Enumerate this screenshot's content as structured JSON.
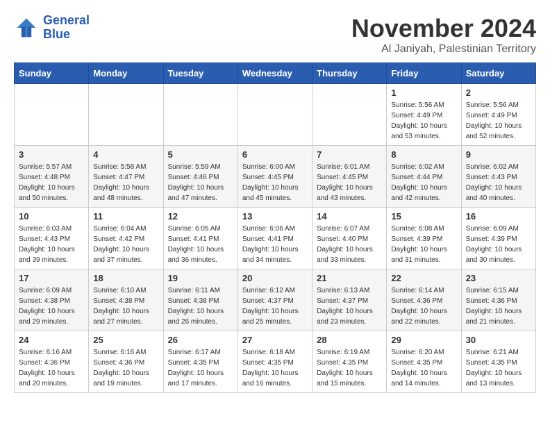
{
  "header": {
    "logo_line1": "General",
    "logo_line2": "Blue",
    "month": "November 2024",
    "location": "Al Janiyah, Palestinian Territory"
  },
  "weekdays": [
    "Sunday",
    "Monday",
    "Tuesday",
    "Wednesday",
    "Thursday",
    "Friday",
    "Saturday"
  ],
  "weeks": [
    [
      {
        "day": "",
        "info": ""
      },
      {
        "day": "",
        "info": ""
      },
      {
        "day": "",
        "info": ""
      },
      {
        "day": "",
        "info": ""
      },
      {
        "day": "",
        "info": ""
      },
      {
        "day": "1",
        "info": "Sunrise: 5:56 AM\nSunset: 4:49 PM\nDaylight: 10 hours\nand 53 minutes."
      },
      {
        "day": "2",
        "info": "Sunrise: 5:56 AM\nSunset: 4:49 PM\nDaylight: 10 hours\nand 52 minutes."
      }
    ],
    [
      {
        "day": "3",
        "info": "Sunrise: 5:57 AM\nSunset: 4:48 PM\nDaylight: 10 hours\nand 50 minutes."
      },
      {
        "day": "4",
        "info": "Sunrise: 5:58 AM\nSunset: 4:47 PM\nDaylight: 10 hours\nand 48 minutes."
      },
      {
        "day": "5",
        "info": "Sunrise: 5:59 AM\nSunset: 4:46 PM\nDaylight: 10 hours\nand 47 minutes."
      },
      {
        "day": "6",
        "info": "Sunrise: 6:00 AM\nSunset: 4:45 PM\nDaylight: 10 hours\nand 45 minutes."
      },
      {
        "day": "7",
        "info": "Sunrise: 6:01 AM\nSunset: 4:45 PM\nDaylight: 10 hours\nand 43 minutes."
      },
      {
        "day": "8",
        "info": "Sunrise: 6:02 AM\nSunset: 4:44 PM\nDaylight: 10 hours\nand 42 minutes."
      },
      {
        "day": "9",
        "info": "Sunrise: 6:02 AM\nSunset: 4:43 PM\nDaylight: 10 hours\nand 40 minutes."
      }
    ],
    [
      {
        "day": "10",
        "info": "Sunrise: 6:03 AM\nSunset: 4:43 PM\nDaylight: 10 hours\nand 39 minutes."
      },
      {
        "day": "11",
        "info": "Sunrise: 6:04 AM\nSunset: 4:42 PM\nDaylight: 10 hours\nand 37 minutes."
      },
      {
        "day": "12",
        "info": "Sunrise: 6:05 AM\nSunset: 4:41 PM\nDaylight: 10 hours\nand 36 minutes."
      },
      {
        "day": "13",
        "info": "Sunrise: 6:06 AM\nSunset: 4:41 PM\nDaylight: 10 hours\nand 34 minutes."
      },
      {
        "day": "14",
        "info": "Sunrise: 6:07 AM\nSunset: 4:40 PM\nDaylight: 10 hours\nand 33 minutes."
      },
      {
        "day": "15",
        "info": "Sunrise: 6:08 AM\nSunset: 4:39 PM\nDaylight: 10 hours\nand 31 minutes."
      },
      {
        "day": "16",
        "info": "Sunrise: 6:09 AM\nSunset: 4:39 PM\nDaylight: 10 hours\nand 30 minutes."
      }
    ],
    [
      {
        "day": "17",
        "info": "Sunrise: 6:09 AM\nSunset: 4:38 PM\nDaylight: 10 hours\nand 29 minutes."
      },
      {
        "day": "18",
        "info": "Sunrise: 6:10 AM\nSunset: 4:38 PM\nDaylight: 10 hours\nand 27 minutes."
      },
      {
        "day": "19",
        "info": "Sunrise: 6:11 AM\nSunset: 4:38 PM\nDaylight: 10 hours\nand 26 minutes."
      },
      {
        "day": "20",
        "info": "Sunrise: 6:12 AM\nSunset: 4:37 PM\nDaylight: 10 hours\nand 25 minutes."
      },
      {
        "day": "21",
        "info": "Sunrise: 6:13 AM\nSunset: 4:37 PM\nDaylight: 10 hours\nand 23 minutes."
      },
      {
        "day": "22",
        "info": "Sunrise: 6:14 AM\nSunset: 4:36 PM\nDaylight: 10 hours\nand 22 minutes."
      },
      {
        "day": "23",
        "info": "Sunrise: 6:15 AM\nSunset: 4:36 PM\nDaylight: 10 hours\nand 21 minutes."
      }
    ],
    [
      {
        "day": "24",
        "info": "Sunrise: 6:16 AM\nSunset: 4:36 PM\nDaylight: 10 hours\nand 20 minutes."
      },
      {
        "day": "25",
        "info": "Sunrise: 6:16 AM\nSunset: 4:36 PM\nDaylight: 10 hours\nand 19 minutes."
      },
      {
        "day": "26",
        "info": "Sunrise: 6:17 AM\nSunset: 4:35 PM\nDaylight: 10 hours\nand 17 minutes."
      },
      {
        "day": "27",
        "info": "Sunrise: 6:18 AM\nSunset: 4:35 PM\nDaylight: 10 hours\nand 16 minutes."
      },
      {
        "day": "28",
        "info": "Sunrise: 6:19 AM\nSunset: 4:35 PM\nDaylight: 10 hours\nand 15 minutes."
      },
      {
        "day": "29",
        "info": "Sunrise: 6:20 AM\nSunset: 4:35 PM\nDaylight: 10 hours\nand 14 minutes."
      },
      {
        "day": "30",
        "info": "Sunrise: 6:21 AM\nSunset: 4:35 PM\nDaylight: 10 hours\nand 13 minutes."
      }
    ]
  ]
}
